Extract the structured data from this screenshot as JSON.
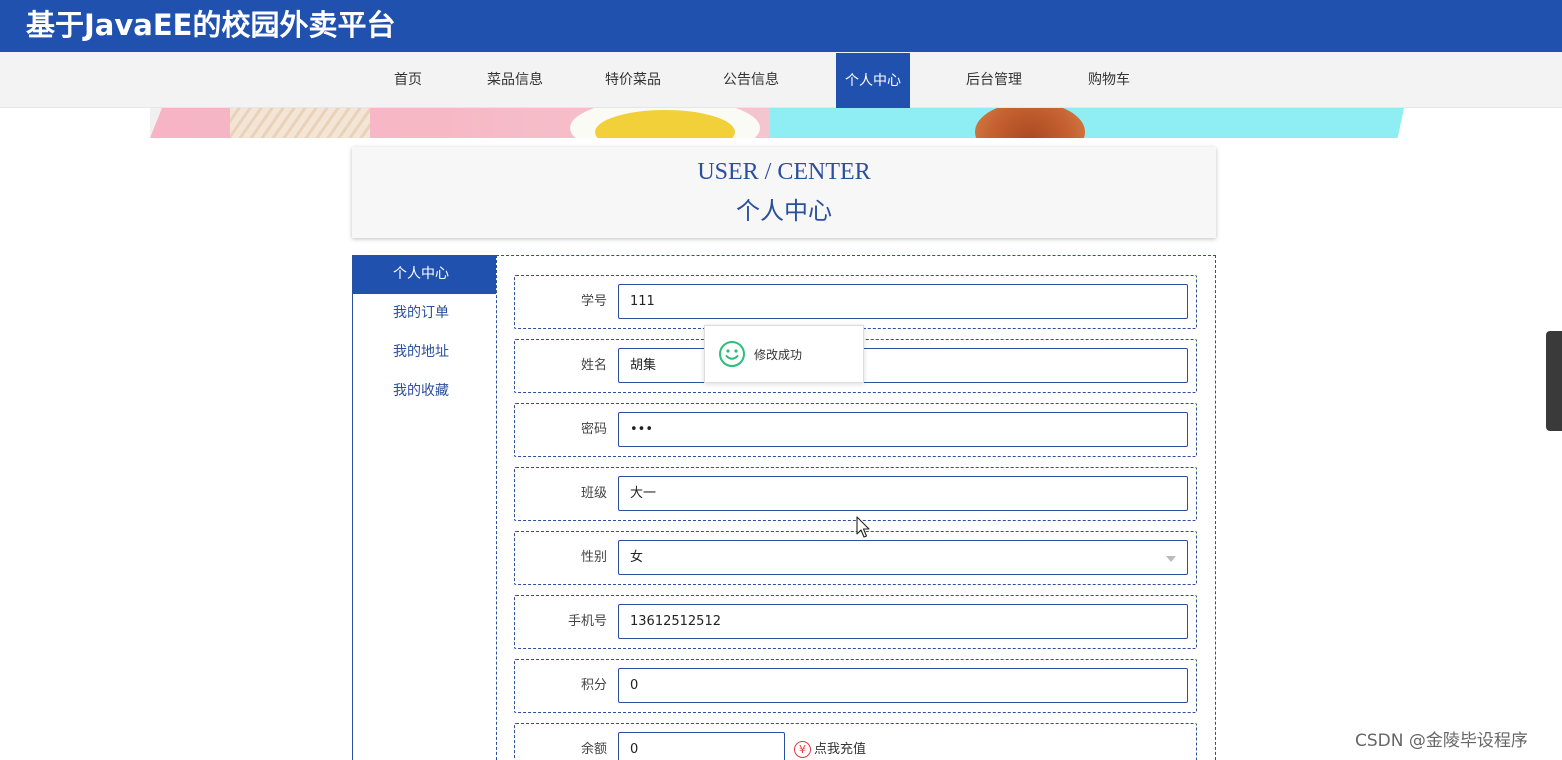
{
  "site": {
    "title": "基于JavaEE的校园外卖平台"
  },
  "nav": {
    "items": [
      {
        "label": "首页"
      },
      {
        "label": "菜品信息"
      },
      {
        "label": "特价菜品"
      },
      {
        "label": "公告信息"
      },
      {
        "label": "个人中心"
      },
      {
        "label": "后台管理"
      },
      {
        "label": "购物车"
      }
    ],
    "active": "个人中心"
  },
  "page_header": {
    "en": "USER / CENTER",
    "zh": "个人中心"
  },
  "side_menu": {
    "items": [
      {
        "label": "个人中心"
      },
      {
        "label": "我的订单"
      },
      {
        "label": "我的地址"
      },
      {
        "label": "我的收藏"
      }
    ],
    "active": "个人中心"
  },
  "form": {
    "student_id": {
      "label": "学号",
      "value": "111"
    },
    "name": {
      "label": "姓名",
      "value": "胡集"
    },
    "password": {
      "label": "密码",
      "value": "•••"
    },
    "class": {
      "label": "班级",
      "value": "大一"
    },
    "gender": {
      "label": "性别",
      "value": "女"
    },
    "phone": {
      "label": "手机号",
      "value": "13612512512"
    },
    "points": {
      "label": "积分",
      "value": "0"
    },
    "balance": {
      "label": "余额",
      "value": "0",
      "recharge_label": "点我充值",
      "recharge_icon": "¥"
    }
  },
  "toast": {
    "message": "修改成功",
    "icon": "smile-icon"
  },
  "watermark": "CSDN @金陵毕设程序",
  "colors": {
    "primary": "#2151af",
    "toast_icon": "#2bbf7a",
    "recharge": "#e23b3b"
  }
}
